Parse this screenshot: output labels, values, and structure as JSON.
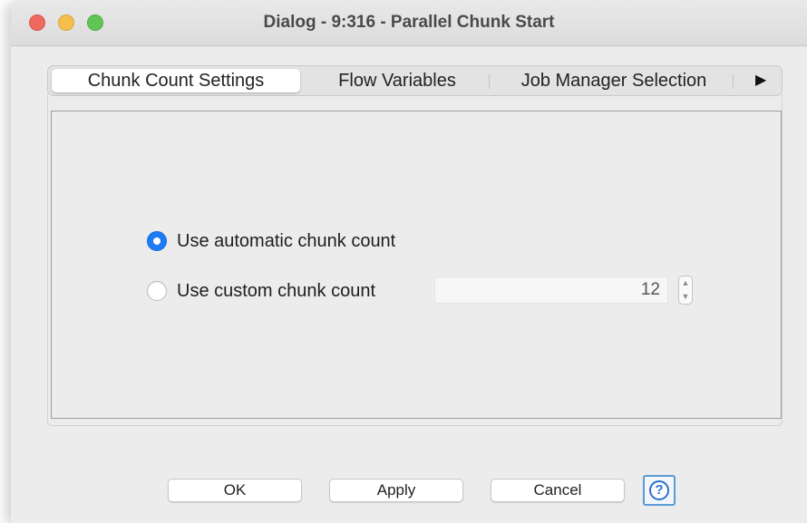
{
  "window": {
    "title": "Dialog - 9:316 - Parallel Chunk Start"
  },
  "tabs": [
    {
      "label": "Chunk Count Settings",
      "active": true
    },
    {
      "label": "Flow Variables",
      "active": false
    },
    {
      "label": "Job Manager Selection",
      "active": false
    }
  ],
  "tab_overflow_icon": "triangle-right-icon",
  "options": {
    "automatic": {
      "label": "Use automatic chunk count",
      "selected": true
    },
    "custom": {
      "label": "Use custom chunk count",
      "selected": false,
      "value": "12"
    }
  },
  "footer": {
    "ok_label": "OK",
    "apply_label": "Apply",
    "cancel_label": "Cancel",
    "help_icon": "help-icon",
    "help_glyph": "?"
  },
  "colors": {
    "accent": "#1b7cf6",
    "close": "#ee6a5e",
    "minimize": "#f5be4f",
    "maximize": "#61c554"
  }
}
